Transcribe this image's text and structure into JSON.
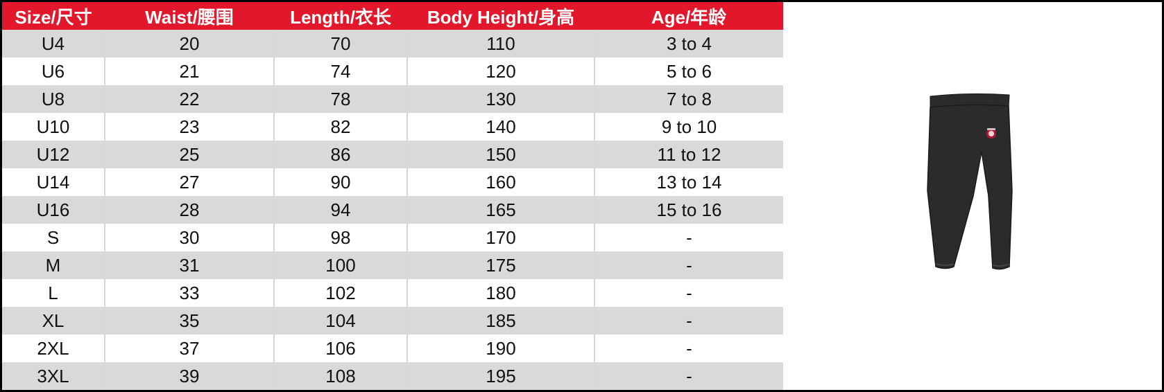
{
  "table": {
    "headers": [
      "Size/尺寸",
      "Waist/腰围",
      "Length/衣长",
      "Body Height/身高",
      "Age/年龄"
    ],
    "rows": [
      [
        "U4",
        "20",
        "70",
        "110",
        "3 to 4"
      ],
      [
        "U6",
        "21",
        "74",
        "120",
        "5 to 6"
      ],
      [
        "U8",
        "22",
        "78",
        "130",
        "7 to 8"
      ],
      [
        "U10",
        "23",
        "82",
        "140",
        "9 to 10"
      ],
      [
        "U12",
        "25",
        "86",
        "150",
        "11 to 12"
      ],
      [
        "U14",
        "27",
        "90",
        "160",
        "13 to 14"
      ],
      [
        "U16",
        "28",
        "94",
        "165",
        "15 to 16"
      ],
      [
        "S",
        "30",
        "98",
        "170",
        "-"
      ],
      [
        "M",
        "31",
        "100",
        "175",
        "-"
      ],
      [
        "L",
        "33",
        "102",
        "180",
        "-"
      ],
      [
        "XL",
        "35",
        "104",
        "185",
        "-"
      ],
      [
        "2XL",
        "37",
        "106",
        "190",
        "-"
      ],
      [
        "3XL",
        "39",
        "108",
        "195",
        "-"
      ]
    ]
  },
  "colors": {
    "header_background": "#e2172b",
    "header_text": "#ffffff",
    "row_shade": "#d9d9d9",
    "pants": "#2b2b2b"
  },
  "product_image": {
    "icon": "track-pants-icon"
  }
}
